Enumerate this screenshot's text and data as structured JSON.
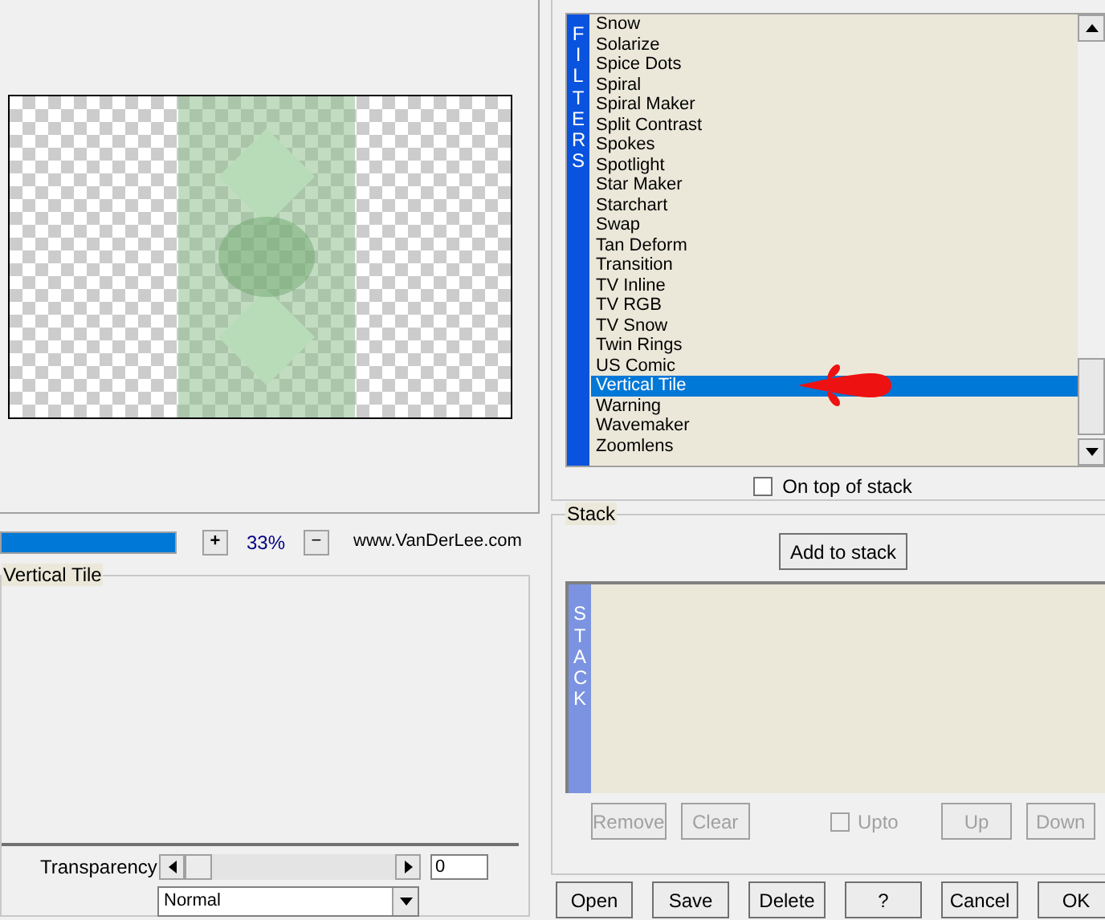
{
  "preview": {
    "zoom_in": "+",
    "zoom": "33%",
    "zoom_out": "−",
    "website": "www.VanDerLee.com",
    "progress": {
      "level": 1
    }
  },
  "settings": {
    "title": "Vertical Tile",
    "transparency": {
      "label": "Transparency",
      "level": 0,
      "value": "0"
    },
    "blend_mode": "Normal"
  },
  "filters": {
    "side_label": "FILTERS",
    "items": [
      {
        "label": "Snow",
        "selected": false
      },
      {
        "label": "Solarize",
        "selected": false
      },
      {
        "label": "Spice Dots",
        "selected": false
      },
      {
        "label": "Spiral",
        "selected": false
      },
      {
        "label": "Spiral Maker",
        "selected": false
      },
      {
        "label": "Split Contrast",
        "selected": false
      },
      {
        "label": "Spokes",
        "selected": false
      },
      {
        "label": "Spotlight",
        "selected": false
      },
      {
        "label": "Star Maker",
        "selected": false
      },
      {
        "label": "Starchart",
        "selected": false
      },
      {
        "label": "Swap",
        "selected": false
      },
      {
        "label": "Tan Deform",
        "selected": false
      },
      {
        "label": "Transition",
        "selected": false
      },
      {
        "label": "TV Inline",
        "selected": false
      },
      {
        "label": "TV RGB",
        "selected": false
      },
      {
        "label": "TV Snow",
        "selected": false
      },
      {
        "label": "Twin Rings",
        "selected": false
      },
      {
        "label": "US Comic",
        "selected": false
      },
      {
        "label": "Vertical Tile",
        "selected": true
      },
      {
        "label": "Warning",
        "selected": false
      },
      {
        "label": "Wavemaker",
        "selected": false
      },
      {
        "label": "Zoomlens",
        "selected": false
      }
    ],
    "on_top": {
      "label": "On top of stack",
      "checked": false
    }
  },
  "stack": {
    "title": "Stack",
    "add_button": "Add to stack",
    "side_label": "STACK",
    "buttons": [
      {
        "label": "Remove",
        "disabled": true
      },
      {
        "label": "Clear",
        "disabled": true
      }
    ],
    "upto": {
      "label": "Upto",
      "checked": false,
      "disabled": true
    },
    "buttons_right": [
      {
        "label": "Up",
        "disabled": true
      },
      {
        "label": "Down",
        "disabled": true
      }
    ]
  },
  "footer_buttons": [
    "Open",
    "Save",
    "Delete",
    "?",
    "Cancel",
    "OK"
  ]
}
